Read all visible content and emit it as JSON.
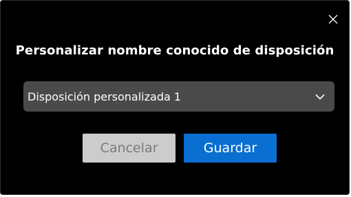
{
  "dialog": {
    "title": "Personalizar nombre conocido de disposición",
    "close_icon": "close-icon",
    "dropdown": {
      "selected": "Disposición personalizada 1",
      "icon": "chevron-down-icon"
    },
    "buttons": {
      "cancel_label": "Cancelar",
      "cancel_enabled": false,
      "save_label": "Guardar"
    }
  },
  "colors": {
    "background": "#000000",
    "dropdown_bg": "#4a4a4a",
    "primary_button": "#0a6fd0",
    "disabled_button": "#cccccc",
    "disabled_text": "#7a7a7a"
  }
}
